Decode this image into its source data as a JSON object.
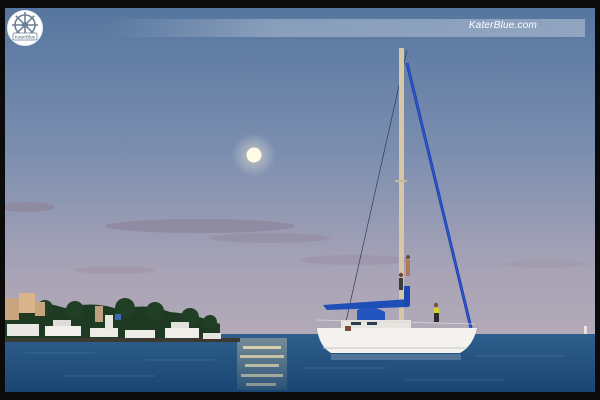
{
  "watermark": {
    "text": "KaterBlue.com",
    "logo_text": "KaterBlue",
    "logo_icon": "ship-wheel-icon"
  },
  "scene": {
    "subject": "sailboat-at-dusk",
    "colors": {
      "sky_top": "#5b7aa3",
      "sky_horizon": "#a9a3b8",
      "sea": "#1f4f7d",
      "hull": "#f3f2ee",
      "bimini": "#1f4fb0",
      "moon": "#fffbe6"
    }
  }
}
